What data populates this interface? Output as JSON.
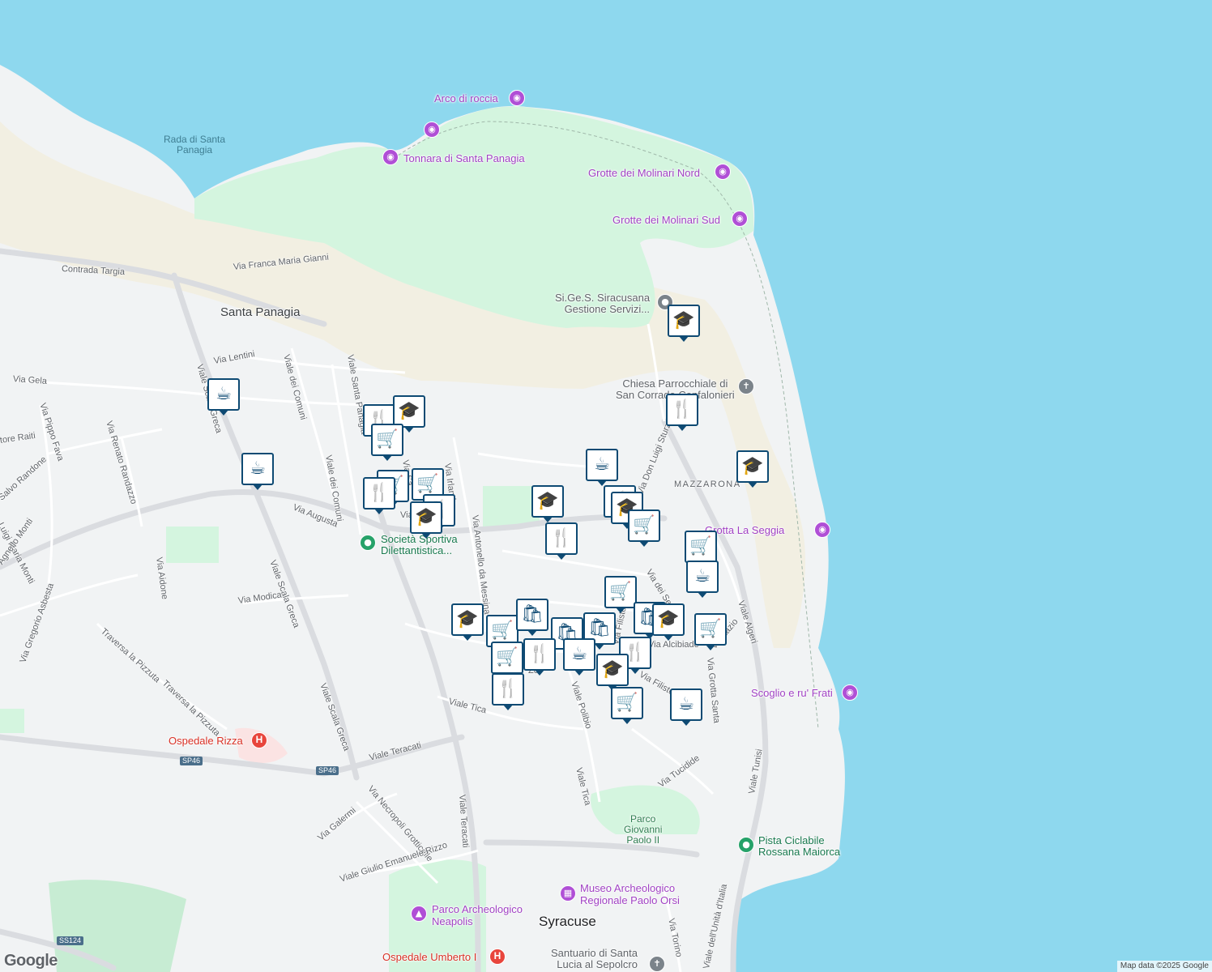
{
  "map": {
    "colors": {
      "sea": "#8ed8ee",
      "land": "#f1f3f4",
      "park": "#d4f5df",
      "beach": "#f2efe2",
      "road": "#ffffff",
      "arterial": "#dadce0",
      "marker_border": "#0e4a73",
      "poi_purple": "#a142c4"
    },
    "places": {
      "santa_panagia": "Santa Panagia",
      "syracuse": "Syracuse",
      "mazzarona": "MAZZARONA",
      "rada": "Rada di Santa\nPanagia"
    },
    "pois": {
      "arco": "Arco di roccia",
      "tonnara": "Tonnara di Santa Panagia",
      "molinari_nord": "Grotte dei Molinari Nord",
      "molinari_sud": "Grotte dei Molinari Sud",
      "sigess": "Si.Ge.S. Siracusana\nGestione Servizi...",
      "chiesa": "Chiesa Parrocchiale di\nSan Corrado Confalonieri",
      "grotta_seggia": "Grotta La Seggia",
      "scoglio": "Scoglio e ru' Frati",
      "societa": "Società Sportiva\nDilettantistica...",
      "rizza": "Ospedale Rizza",
      "parco_gp": "Parco\nGiovanni\nPaolo II",
      "pista": "Pista Ciclabile\nRossana Maiorca",
      "museo": "Museo Archeologico\nRegionale Paolo Orsi",
      "neapolis": "Parco Archeologico\nNeapolis",
      "umberto": "Ospedale Umberto I",
      "santuario": "Santuario di Santa\nLucia al Sepolcro"
    },
    "streets": {
      "contrada_targia": "Contrada Targia",
      "franca_maria": "Via Franca Maria Gianni",
      "lentini": "Via Lentini",
      "gela": "Via Gela",
      "viale_greca_top": "Viale Scala Greca",
      "viale_comuni": "Viale dei Comuni",
      "via_comuni": "Viale dei Comuni",
      "santa_panag": "Viale Santa Panagia",
      "pippo_fava": "Via Pippo Fava",
      "renato": "Via Renato Randazzo",
      "tore_raiti": "tore Raiti",
      "salvo": "Salvo Randone",
      "luigi_monti": "Luigi Maria Monti",
      "gnello": "Agnello Monti",
      "aidone": "Via Aidone",
      "gregorio": "Via Gregorio Asbesta",
      "augusta": "Via Augusta",
      "modica": "Via Modica",
      "scala_greca_1": "Viale Scala Greca",
      "scala_greca_2": "Viale Scala Greca",
      "pizzuta_1": "Traversa la Pizzuta",
      "pizzuta_2": "Traversa la Pizzuta",
      "teracati_h": "Viale Teracati",
      "teracati_v": "Viale Teracati",
      "irlanda": "Via Irlanda",
      "antonello": "Via Antonello da Messina",
      "don_luigi": "Via Don Luigi Sturzo",
      "via_dei_ser": "Via dei Servi",
      "lazio": "Via Lazio",
      "algeri": "Viale Algeri",
      "grotta_santa": "Via Grotta Santa",
      "filisto": "Via Filisto",
      "fili": "Via Filisto",
      "alcibiade": "Via Alcibiade",
      "tica": "Viale Tica",
      "tica_v": "Viale Tica",
      "polibio": "Viale Polibio",
      "tucidide": "Via Tucidide",
      "tunisi": "Viale Tunisi",
      "necropoli": "Via Necropoli Grotticelle",
      "galermi": "Via Galermi",
      "giulio": "Viale Giulio Emanuele Rizzo",
      "torino": "Via Torino",
      "unita": "Viale dell'Unità d'Italia",
      "via_v": "Via",
      "via_sa": "Via Sa",
      "v_zo": "Zo"
    },
    "shields": {
      "sp46a": "SP46",
      "sp46b": "SP46",
      "ss124": "SS124"
    },
    "markers": [
      {
        "kind": "cafe",
        "icon": "☕"
      },
      {
        "kind": "restaurant",
        "icon": "🍴"
      },
      {
        "kind": "school",
        "icon": "🎓"
      },
      {
        "kind": "grocery",
        "icon": "🛒"
      },
      {
        "kind": "shopping",
        "icon": "🛍"
      }
    ],
    "pin_glyphs": {
      "camera": "◉",
      "place": "●",
      "church": "✝",
      "hospital": "H",
      "museum": "▦",
      "park": "▲"
    },
    "logo": "Google",
    "attribution": "Map data ©2025 Google"
  }
}
